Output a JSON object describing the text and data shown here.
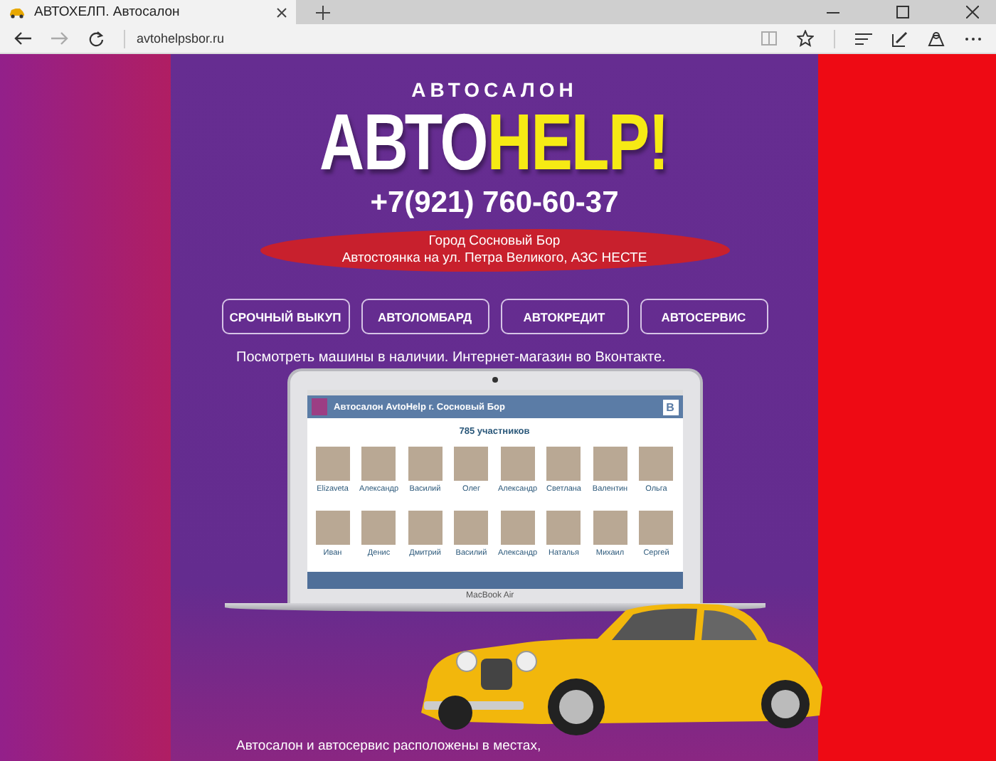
{
  "browser": {
    "tab_title": "АВТОХЕЛП. Автосалон",
    "address": "avtohelpsbor.ru"
  },
  "header": {
    "subtitle": "АВТОСАЛОН",
    "logo_white": "АВТО",
    "logo_yellow": "HELP!",
    "phone": "+7(921) 760-60-37",
    "address_lines": [
      "Город Сосновый Бор",
      "Автостоянка на ул. Петра Великого, АЗС НЕСТЕ"
    ]
  },
  "nav_buttons": [
    "СРОЧНЫЙ ВЫКУП",
    "АВТОЛОМБАРД",
    "АВТОКРЕДИТ",
    "АВТОСЕРВИС"
  ],
  "shop_text": "Посмотреть машины в наличии. Интернет-магазин во Вконтакте.",
  "laptop": {
    "group_title": "Автосалон AvtoHelp г. Сосновый Бор",
    "badge": "В",
    "members_count": "785 участников",
    "members": [
      "Elizaveta",
      "Александр",
      "Василий",
      "Олег",
      "Александр",
      "Светлана",
      "Валентин",
      "Ольга",
      "Иван",
      "Денис",
      "Дмитрий",
      "Василий",
      "Александр",
      "Наталья",
      "Михаил",
      "Сергей"
    ],
    "model": "MacBook Air"
  },
  "footer_text": "Автосалон и автосервис расположены в местах,"
}
